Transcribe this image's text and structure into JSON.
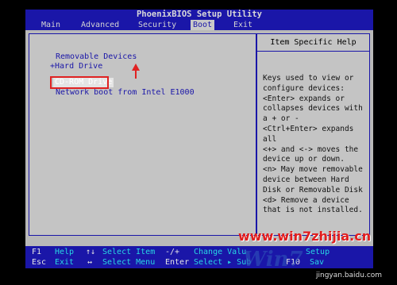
{
  "title": "PhoenixBIOS Setup Utility",
  "menu": [
    "Main",
    "Advanced",
    "Security",
    "Boot",
    "Exit"
  ],
  "active_menu": "Boot",
  "boot_items": [
    "Removable Devices",
    "+Hard Drive",
    "CD-ROM Drive",
    "Network boot from Intel E1000"
  ],
  "help": {
    "header": "Item Specific Help",
    "lines": [
      "Keys used to view or",
      "configure devices:",
      "<Enter> expands or",
      "collapses devices with",
      "a + or -",
      "<Ctrl+Enter> expands",
      "all",
      "<+> and <-> moves the",
      "device up or down.",
      "<n> May move removable",
      "device between Hard",
      "Disk or Removable Disk",
      "<d> Remove a device",
      "that is not installed."
    ]
  },
  "footer": {
    "row1": [
      {
        "key": "F1",
        "desc": "Help"
      },
      {
        "key": "↑↓",
        "desc": "Select Item"
      },
      {
        "key": "-/+",
        "desc": "Change Valu"
      },
      {
        "key": "",
        "desc": "Setup"
      }
    ],
    "row2": [
      {
        "key": "Esc",
        "desc": "Exit"
      },
      {
        "key": "↔",
        "desc": "Select Menu"
      },
      {
        "key": "Enter",
        "desc": "Select ▸ Sub"
      },
      {
        "key": "F10",
        "desc": "Sav"
      }
    ]
  },
  "watermark": {
    "site": "www.win7zhijia.cn",
    "logo": "Win7",
    "source": "jingyan.baidu.com"
  }
}
